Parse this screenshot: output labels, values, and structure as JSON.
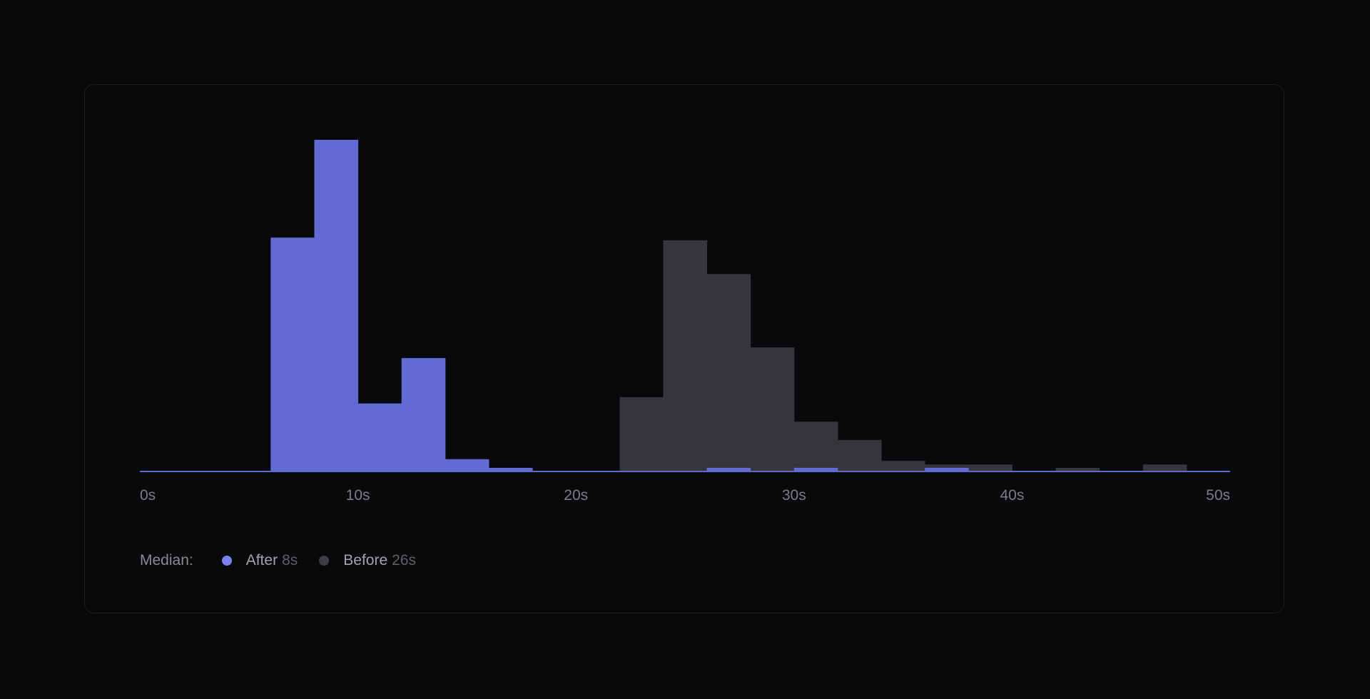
{
  "colors": {
    "after": "#626bd4",
    "after_dot": "#7a82f0",
    "before": "#35353b",
    "before_dot": "#3d3d42",
    "baseline": "#626bd4"
  },
  "chart_data": {
    "type": "bar",
    "xlabel": "",
    "ylabel": "",
    "xlim": [
      0,
      50
    ],
    "ylim": [
      0,
      100
    ],
    "x_ticks": [
      "0s",
      "10s",
      "20s",
      "30s",
      "40s",
      "50s"
    ],
    "grid": false,
    "legend_placement": "bottom-left",
    "bin_width": 2,
    "bin_starts": [
      0,
      2,
      4,
      6,
      8,
      10,
      12,
      14,
      16,
      18,
      20,
      22,
      24,
      26,
      28,
      30,
      32,
      34,
      36,
      38,
      40,
      42,
      44,
      46,
      48
    ],
    "series": [
      {
        "name": "After",
        "values": [
          0,
          0,
          0,
          70.5,
          100,
          20.5,
          34.2,
          3.7,
          1.1,
          0,
          0,
          0,
          0,
          1.1,
          0,
          1.1,
          0,
          0,
          1.1,
          0,
          0,
          0,
          0,
          0,
          0
        ]
      },
      {
        "name": "Before",
        "values": [
          0,
          0,
          0,
          0,
          0,
          0,
          0,
          0,
          0,
          0,
          0,
          22.4,
          69.7,
          59.5,
          37.4,
          15.0,
          9.5,
          3.2,
          2.1,
          2.1,
          0,
          1.1,
          0,
          2.1,
          0
        ]
      }
    ]
  },
  "legend": {
    "title": "Median:",
    "items": [
      {
        "label": "After",
        "value": "8s"
      },
      {
        "label": "Before",
        "value": "26s"
      }
    ]
  }
}
